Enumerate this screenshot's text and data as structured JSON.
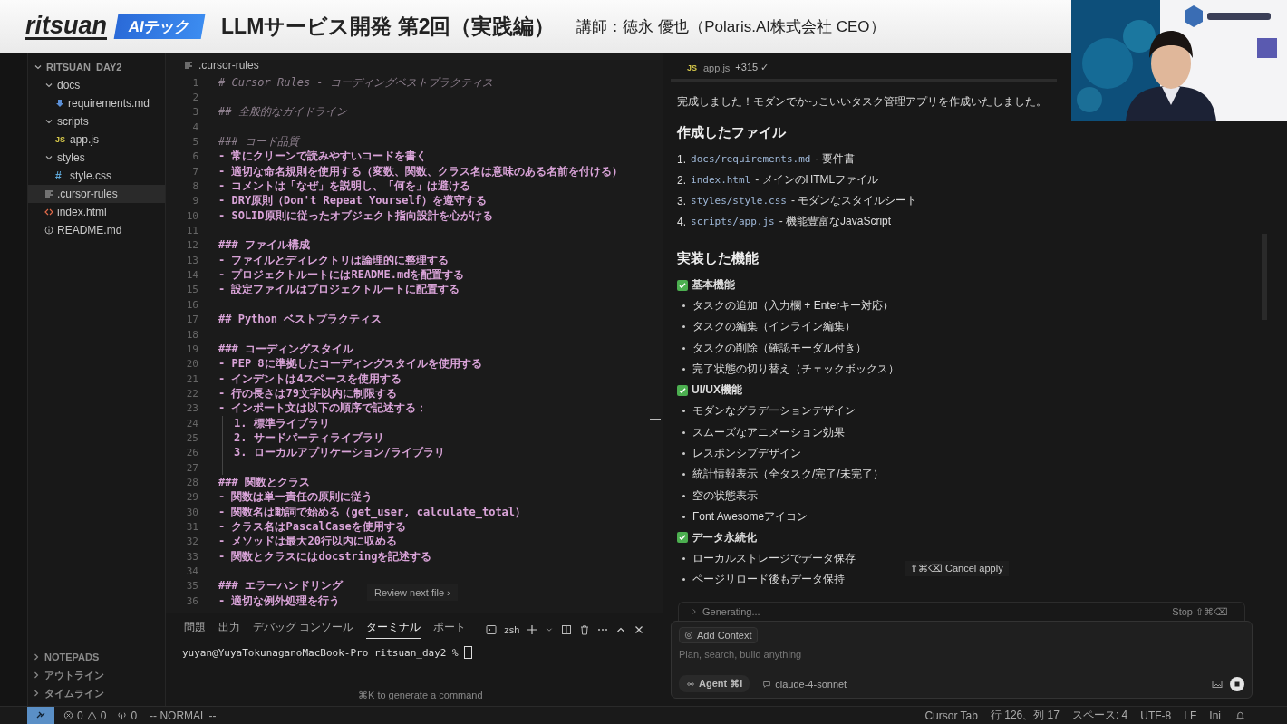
{
  "banner": {
    "logo": "ritsuan",
    "badge": "AIテック",
    "title": "LLMサービス開発 第2回（実践編）",
    "lecturer": "講師：徳永 優也（Polaris.AI株式会社 CEO）"
  },
  "sidebar": {
    "tree": [
      {
        "label": "RITSUAN_DAY2",
        "kind": "folder",
        "expanded": true,
        "selected": false,
        "children": [
          {
            "label": "docs",
            "kind": "folder",
            "expanded": true,
            "selected": false,
            "children": [
              {
                "label": "requirements.md",
                "kind": "download",
                "selected": false
              }
            ]
          },
          {
            "label": "scripts",
            "kind": "folder",
            "expanded": true,
            "selected": false,
            "children": [
              {
                "label": "app.js",
                "kind": "glyph",
                "glyph": "JS",
                "selected": false
              }
            ]
          },
          {
            "label": "styles",
            "kind": "folder",
            "expanded": true,
            "selected": false,
            "children": [
              {
                "label": "style.css",
                "kind": "glyph",
                "glyph": "#",
                "selected": false
              }
            ]
          },
          {
            "label": ".cursor-rules",
            "kind": "lines",
            "selected": true
          },
          {
            "label": "index.html",
            "kind": "code",
            "selected": false
          },
          {
            "label": "README.md",
            "kind": "info",
            "selected": false
          }
        ]
      }
    ],
    "sections": [
      {
        "label": "NOTEPADS",
        "expanded": false
      },
      {
        "label": "アウトライン",
        "expanded": false
      },
      {
        "label": "タイムライン",
        "expanded": false
      }
    ]
  },
  "editor": {
    "breadcrumb": ".cursor-rules",
    "lines": [
      {
        "n": "1",
        "kind": "faded",
        "text": "# Cursor Rules - コーディングベストプラクティス"
      },
      {
        "n": "2",
        "kind": "normal"
      },
      {
        "n": "3",
        "kind": "faded",
        "text": "## 全般的なガイドライン"
      },
      {
        "n": "4",
        "kind": "normal"
      },
      {
        "n": "5",
        "kind": "faded",
        "text": "### コード品質"
      },
      {
        "n": "6",
        "kind": "normal",
        "text": "- 常にクリーンで読みやすいコードを書く"
      },
      {
        "n": "7",
        "kind": "normal",
        "text": "- 適切な命名規則を使用する（変数、関数、クラス名は意味のある名前を付ける）"
      },
      {
        "n": "8",
        "kind": "normal",
        "text": "- コメントは「なぜ」を説明し、「何を」は避ける"
      },
      {
        "n": "9",
        "kind": "normal",
        "text": "- DRY原則（Don't Repeat Yourself）を遵守する"
      },
      {
        "n": "10",
        "kind": "normal",
        "text": "- SOLID原則に従ったオブジェクト指向設計を心がける"
      },
      {
        "n": "11",
        "kind": "normal"
      },
      {
        "n": "12",
        "kind": "normal",
        "text": "### ファイル構成"
      },
      {
        "n": "13",
        "kind": "normal",
        "text": "- ファイルとディレクトリは論理的に整理する"
      },
      {
        "n": "14",
        "kind": "normal",
        "text": "- プロジェクトルートにはREADME.mdを配置する"
      },
      {
        "n": "15",
        "kind": "normal",
        "text": "- 設定ファイルはプロジェクトルートに配置する"
      },
      {
        "n": "16",
        "kind": "normal"
      },
      {
        "n": "17",
        "kind": "normal",
        "text": "## Python ベストプラクティス"
      },
      {
        "n": "18",
        "kind": "normal"
      },
      {
        "n": "19",
        "kind": "normal",
        "text": "### コーディングスタイル"
      },
      {
        "n": "20",
        "kind": "normal",
        "text": "- PEP 8に準拠したコーディングスタイルを使用する"
      },
      {
        "n": "21",
        "kind": "normal",
        "text": "- インデントは4スペースを使用する"
      },
      {
        "n": "22",
        "kind": "normal",
        "text": "- 行の長さは79文字以内に制限する"
      },
      {
        "n": "23",
        "kind": "normal",
        "text": "- インポート文は以下の順序で記述する："
      },
      {
        "n": "24",
        "kind": "nested",
        "text": "1. 標準ライブラリ"
      },
      {
        "n": "25",
        "kind": "nested",
        "text": "2. サードパーティライブラリ"
      },
      {
        "n": "26",
        "kind": "nested",
        "text": "3. ローカルアプリケーション/ライブラリ"
      },
      {
        "n": "27",
        "kind": "nested"
      },
      {
        "n": "28",
        "kind": "normal",
        "text": "### 関数とクラス"
      },
      {
        "n": "29",
        "kind": "normal",
        "text": "- 関数は単一責任の原則に従う"
      },
      {
        "n": "30",
        "kind": "normal",
        "text": "- 関数名は動詞で始める（get_user, calculate_total）"
      },
      {
        "n": "31",
        "kind": "normal",
        "text": "- クラス名はPascalCaseを使用する"
      },
      {
        "n": "32",
        "kind": "normal",
        "text": "- メソッドは最大20行以内に収める"
      },
      {
        "n": "33",
        "kind": "normal",
        "text": "- 関数とクラスにはdocstringを記述する"
      },
      {
        "n": "34",
        "kind": "normal"
      },
      {
        "n": "35",
        "kind": "normal",
        "text": "### エラーハンドリング"
      },
      {
        "n": "36",
        "kind": "normal",
        "text": "- 適切な例外処理を行う"
      }
    ],
    "review_button": "Review next file ›"
  },
  "panel": {
    "tabs": [
      {
        "label": "問題",
        "selected": false
      },
      {
        "label": "出力",
        "selected": false
      },
      {
        "label": "デバッグ コンソール",
        "selected": false
      },
      {
        "label": "ターミナル",
        "selected": true
      },
      {
        "label": "ポート",
        "selected": false
      }
    ],
    "shell": "zsh",
    "prompt": "yuyan@YuyaTokunaganoMacBook-Pro ritsuan_day2 % ",
    "hint": "⌘K to generate a command"
  },
  "chat": {
    "file_chip": {
      "glyph": "JS",
      "name": "app.js",
      "change": "+315 ✓"
    },
    "intro": "完成しました！モダンでかっこいいタスク管理アプリを作成いたしました。",
    "files_heading": "作成したファイル",
    "files": [
      {
        "num": "1.",
        "code": "docs/requirements.md",
        "desc": "- 要件書"
      },
      {
        "num": "2.",
        "code": "index.html",
        "desc": "- メインのHTMLファイル"
      },
      {
        "num": "3.",
        "code": "styles/style.css",
        "desc": "- モダンなスタイルシート"
      },
      {
        "num": "4.",
        "code": "scripts/app.js",
        "desc": "- 機能豊富なJavaScript"
      }
    ],
    "features_heading": "実装した機能",
    "sections": [
      {
        "title": "基本機能",
        "items": [
          "タスクの追加（入力欄 + Enterキー対応）",
          "タスクの編集（インライン編集）",
          "タスクの削除（確認モーダル付き）",
          "完了状態の切り替え（チェックボックス）"
        ]
      },
      {
        "title": "UI/UX機能",
        "items": [
          "モダンなグラデーションデザイン",
          "スムーズなアニメーション効果",
          "レスポンシブデザイン",
          "統計情報表示（全タスク/完了/未完了）",
          "空の状態表示",
          "Font Awesomeアイコン"
        ]
      },
      {
        "title": "データ永続化",
        "items": [
          "ローカルストレージでデータ保存",
          "ページリロード後もデータ保持"
        ]
      }
    ],
    "cancel_apply": "⇧⌘⌫ Cancel apply",
    "generating": "Generating...",
    "stop": "Stop ⇧⌘⌫",
    "add_context": "Add Context",
    "placeholder": "Plan, search, build anything",
    "mode": "Agent ⌘I",
    "model": "claude-4-sonnet"
  },
  "status_bar": {
    "errors": "0",
    "warnings": "0",
    "ports": "0",
    "vim_mode": "-- NORMAL --",
    "right": [
      "Cursor Tab",
      "行 126、列 17",
      "スペース: 4",
      "UTF-8",
      "LF",
      "Ini"
    ]
  }
}
